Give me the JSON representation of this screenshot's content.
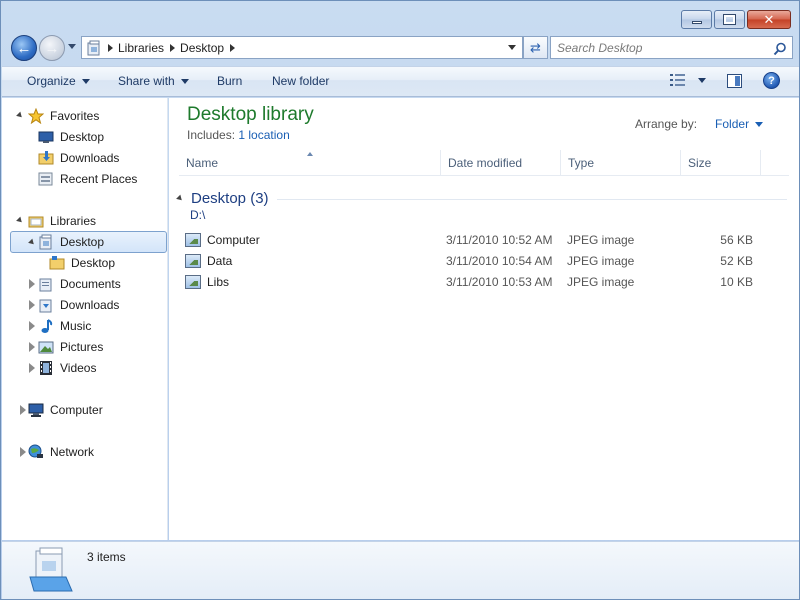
{
  "address": {
    "crumbs": [
      "Libraries",
      "Desktop"
    ]
  },
  "search": {
    "placeholder": "Search Desktop"
  },
  "toolbar": {
    "organize": "Organize",
    "share_with": "Share with",
    "burn": "Burn",
    "new_folder": "New folder",
    "help": "?"
  },
  "nav_pane": {
    "favorites": {
      "label": "Favorites",
      "items": [
        "Desktop",
        "Downloads",
        "Recent Places"
      ]
    },
    "libraries": {
      "label": "Libraries",
      "desktop": "Desktop",
      "desktop_child": "Desktop",
      "items": [
        "Documents",
        "Downloads",
        "Music",
        "Pictures",
        "Videos"
      ]
    },
    "computer": "Computer",
    "network": "Network"
  },
  "content": {
    "title": "Desktop library",
    "includes_label": "Includes:",
    "includes_link": "1 location",
    "arrange_label": "Arrange by:",
    "arrange_value": "Folder",
    "columns": [
      "Name",
      "Date modified",
      "Type",
      "Size"
    ],
    "group": {
      "name": "Desktop (3)",
      "path": "D:\\"
    },
    "files": [
      {
        "name": "Computer",
        "date": "3/11/2010 10:52 AM",
        "type": "JPEG image",
        "size": "56 KB"
      },
      {
        "name": "Data",
        "date": "3/11/2010 10:54 AM",
        "type": "JPEG image",
        "size": "52 KB"
      },
      {
        "name": "Libs",
        "date": "3/11/2010 10:53 AM",
        "type": "JPEG image",
        "size": "10 KB"
      }
    ]
  },
  "details": {
    "item_count": "3 items"
  },
  "colors": {
    "library_title": "#1e7a2c",
    "link": "#1a5fb4",
    "group_header": "#1e3f82",
    "selection_border": "#7da2ce"
  },
  "icons": {
    "back": "back-arrow-icon",
    "forward": "forward-arrow-icon",
    "search": "magnifier-icon",
    "favorites": "star-icon",
    "libraries": "library-folder-icon",
    "computer": "computer-icon",
    "network": "network-globe-icon"
  }
}
